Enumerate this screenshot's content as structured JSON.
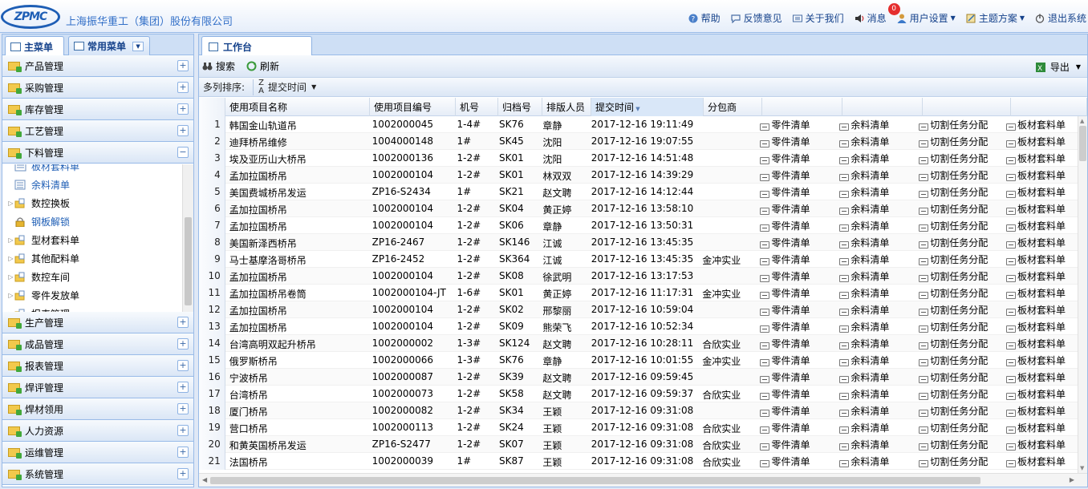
{
  "header": {
    "logo_text": "ZPMC",
    "company_name": "上海振华重工（集团）股份有限公司",
    "nav": [
      {
        "name": "help",
        "label": "帮助",
        "icon": "help-icon"
      },
      {
        "name": "feedback",
        "label": "反馈意见",
        "icon": "feedback-icon"
      },
      {
        "name": "about",
        "label": "关于我们",
        "icon": "about-icon"
      },
      {
        "name": "messages",
        "label": "消息",
        "icon": "speaker-icon",
        "badge": "0"
      },
      {
        "name": "user-settings",
        "label": "用户设置",
        "icon": "user-icon",
        "dropdown": true
      },
      {
        "name": "theme",
        "label": "主题方案",
        "icon": "theme-icon",
        "dropdown": true
      },
      {
        "name": "logout",
        "label": "退出系统",
        "icon": "power-icon"
      }
    ]
  },
  "left_panel": {
    "tabs": [
      "主菜单",
      "常用菜单"
    ],
    "accordion_top": [
      {
        "label": "产品管理",
        "toggle": "+"
      },
      {
        "label": "采购管理",
        "toggle": "+"
      },
      {
        "label": "库存管理",
        "toggle": "+"
      },
      {
        "label": "工艺管理",
        "toggle": "+"
      },
      {
        "label": "下料管理",
        "toggle": "−"
      }
    ],
    "tree_items": [
      {
        "label": "板材套料单",
        "icon": "doc-icon",
        "expandable": false
      },
      {
        "label": "余料清单",
        "icon": "list-icon",
        "expandable": false
      },
      {
        "label": "数控换板",
        "icon": "folder-icon",
        "expandable": true
      },
      {
        "label": "钢板解锁",
        "icon": "lock-icon",
        "expandable": false
      },
      {
        "label": "型材套料单",
        "icon": "folder-icon",
        "expandable": true
      },
      {
        "label": "其他配料单",
        "icon": "folder-icon",
        "expandable": true
      },
      {
        "label": "数控车间",
        "icon": "folder-icon",
        "expandable": true
      },
      {
        "label": "零件发放单",
        "icon": "folder-icon",
        "expandable": true
      },
      {
        "label": "报表管理",
        "icon": "folder-icon",
        "expandable": true
      }
    ],
    "accordion_bottom": [
      {
        "label": "生产管理",
        "toggle": "+"
      },
      {
        "label": "成品管理",
        "toggle": "+"
      },
      {
        "label": "报表管理",
        "toggle": "+"
      },
      {
        "label": "焊评管理",
        "toggle": "+"
      },
      {
        "label": "焊材领用",
        "toggle": "+"
      },
      {
        "label": "人力资源",
        "toggle": "+"
      },
      {
        "label": "运维管理",
        "toggle": "+"
      },
      {
        "label": "系统管理",
        "toggle": "+"
      }
    ]
  },
  "workspace": {
    "tab": "工作台",
    "toolbar": {
      "search": "搜索",
      "refresh": "刷新",
      "export": "导出"
    },
    "sortbar": {
      "label": "多列排序:",
      "sort_field": "提交时间"
    },
    "columns": [
      "使用项目名称",
      "使用项目编号",
      "机号",
      "归档号",
      "排版人员",
      "提交时间",
      "分包商",
      "",
      "",
      "",
      ""
    ],
    "sorted_column": 5,
    "action_labels": [
      "零件清单",
      "余料清单",
      "切割任务分配",
      "板材套料单"
    ],
    "rows": [
      [
        "1",
        "韩国金山轨道吊",
        "1002000045",
        "1-4#",
        "SK76",
        "章静",
        "2017-12-16 19:11:49",
        ""
      ],
      [
        "2",
        "迪拜桥吊维修",
        "1004000148",
        "1#",
        "SK45",
        "沈阳",
        "2017-12-16 19:07:55",
        ""
      ],
      [
        "3",
        "埃及亚历山大桥吊",
        "1002000136",
        "1-2#",
        "SK01",
        "沈阳",
        "2017-12-16 14:51:48",
        ""
      ],
      [
        "4",
        "孟加拉国桥吊",
        "1002000104",
        "1-2#",
        "SK01",
        "林双双",
        "2017-12-16 14:39:29",
        ""
      ],
      [
        "5",
        "美国费城桥吊发运",
        "ZP16-S2434",
        "1#",
        "SK21",
        "赵文聘",
        "2017-12-16 14:12:44",
        ""
      ],
      [
        "6",
        "孟加拉国桥吊",
        "1002000104",
        "1-2#",
        "SK04",
        "黄正婷",
        "2017-12-16 13:58:10",
        ""
      ],
      [
        "7",
        "孟加拉国桥吊",
        "1002000104",
        "1-2#",
        "SK06",
        "章静",
        "2017-12-16 13:50:31",
        ""
      ],
      [
        "8",
        "美国新泽西桥吊",
        "ZP16-2467",
        "1-2#",
        "SK146",
        "江诚",
        "2017-12-16 13:45:35",
        ""
      ],
      [
        "9",
        "马士基摩洛哥桥吊",
        "ZP16-2452",
        "1-2#",
        "SK364",
        "江诚",
        "2017-12-16 13:45:35",
        "金冲实业"
      ],
      [
        "10",
        "孟加拉国桥吊",
        "1002000104",
        "1-2#",
        "SK08",
        "徐武明",
        "2017-12-16 13:17:53",
        ""
      ],
      [
        "11",
        "孟加拉国桥吊卷筒",
        "1002000104-JT",
        "1-6#",
        "SK01",
        "黄正婷",
        "2017-12-16 11:17:31",
        "金冲实业"
      ],
      [
        "12",
        "孟加拉国桥吊",
        "1002000104",
        "1-2#",
        "SK02",
        "邢黎丽",
        "2017-12-16 10:59:04",
        ""
      ],
      [
        "13",
        "孟加拉国桥吊",
        "1002000104",
        "1-2#",
        "SK09",
        "熊荣飞",
        "2017-12-16 10:52:34",
        ""
      ],
      [
        "14",
        "台湾高明双起升桥吊",
        "1002000002",
        "1-3#",
        "SK124",
        "赵文聘",
        "2017-12-16 10:28:11",
        "合欣实业"
      ],
      [
        "15",
        "俄罗斯桥吊",
        "1002000066",
        "1-3#",
        "SK76",
        "章静",
        "2017-12-16 10:01:55",
        "金冲实业"
      ],
      [
        "16",
        "宁波桥吊",
        "1002000087",
        "1-2#",
        "SK39",
        "赵文聘",
        "2017-12-16 09:59:45",
        ""
      ],
      [
        "17",
        "台湾桥吊",
        "1002000073",
        "1-2#",
        "SK58",
        "赵文聘",
        "2017-12-16 09:59:37",
        "合欣实业"
      ],
      [
        "18",
        "厦门桥吊",
        "1002000082",
        "1-2#",
        "SK34",
        "王颖",
        "2017-12-16 09:31:08",
        ""
      ],
      [
        "19",
        "营口桥吊",
        "1002000113",
        "1-2#",
        "SK24",
        "王颖",
        "2017-12-16 09:31:08",
        "合欣实业"
      ],
      [
        "20",
        "和黄英国桥吊发运",
        "ZP16-S2477",
        "1-2#",
        "SK07",
        "王颖",
        "2017-12-16 09:31:08",
        "合欣实业"
      ],
      [
        "21",
        "法国桥吊",
        "1002000039",
        "1#",
        "SK87",
        "王颖",
        "2017-12-16 09:31:08",
        "合欣实业"
      ]
    ]
  }
}
